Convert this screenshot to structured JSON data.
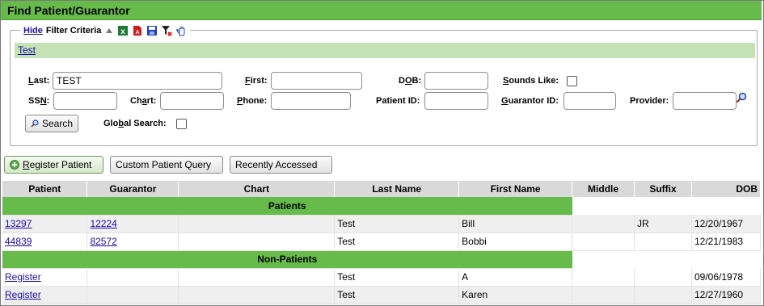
{
  "title": "Find Patient/Guarantor",
  "filter": {
    "hide_link": "Hide",
    "label": "Filter Criteria",
    "saved_filter": "Test",
    "fields": {
      "last_label_pre": "",
      "last_label_u": "L",
      "last_label_post": "ast:",
      "last_value": "TEST",
      "first_label_u": "F",
      "first_label_post": "irst:",
      "dob_label_pre": "D",
      "dob_label_u": "O",
      "dob_label_post": "B:",
      "sounds_like_label_u": "S",
      "sounds_like_label_post": "ounds Like:",
      "ssn_label_pre": "SS",
      "ssn_label_u": "N",
      "ssn_label_post": ":",
      "chart_label_pre": "Ch",
      "chart_label_u": "a",
      "chart_label_post": "rt:",
      "phone_label_u": "P",
      "phone_label_post": "hone:",
      "patient_id_label": "Patient ID:",
      "guarantor_id_label_u": "G",
      "guarantor_id_label_post": "uarantor ID:",
      "provider_label": "Provider:",
      "global_label_pre": "Glo",
      "global_label_u": "b",
      "global_label_post": "al Search:"
    },
    "search_button": "Search"
  },
  "actions": {
    "register_pre": "",
    "register_u": "R",
    "register_post": "egister Patient",
    "custom_query": "Custom Patient Query",
    "recently_accessed": "Recently Accessed"
  },
  "table": {
    "headers": [
      "Patient",
      "Guarantor",
      "Chart",
      "Last Name",
      "First Name",
      "Middle",
      "Suffix",
      "DOB"
    ],
    "group_patients": "Patients",
    "group_nonpatients": "Non-Patients",
    "patients": [
      {
        "patient": "13297",
        "guarantor": "12224",
        "chart": "",
        "last": "Test",
        "first": "Bill",
        "middle": "",
        "suffix": "JR",
        "dob": "12/20/1967"
      },
      {
        "patient": "44839",
        "guarantor": "82572",
        "chart": "",
        "last": "Test",
        "first": "Bobbi",
        "middle": "",
        "suffix": "",
        "dob": "12/21/1983"
      }
    ],
    "nonpatients": [
      {
        "patient": "Register",
        "guarantor": "",
        "chart": "",
        "last": "Test",
        "first": "A",
        "middle": "",
        "suffix": "",
        "dob": "09/06/1978"
      },
      {
        "patient": "Register",
        "guarantor": "",
        "chart": "",
        "last": "Test",
        "first": "Karen",
        "middle": "",
        "suffix": "",
        "dob": "12/27/1960"
      }
    ]
  }
}
